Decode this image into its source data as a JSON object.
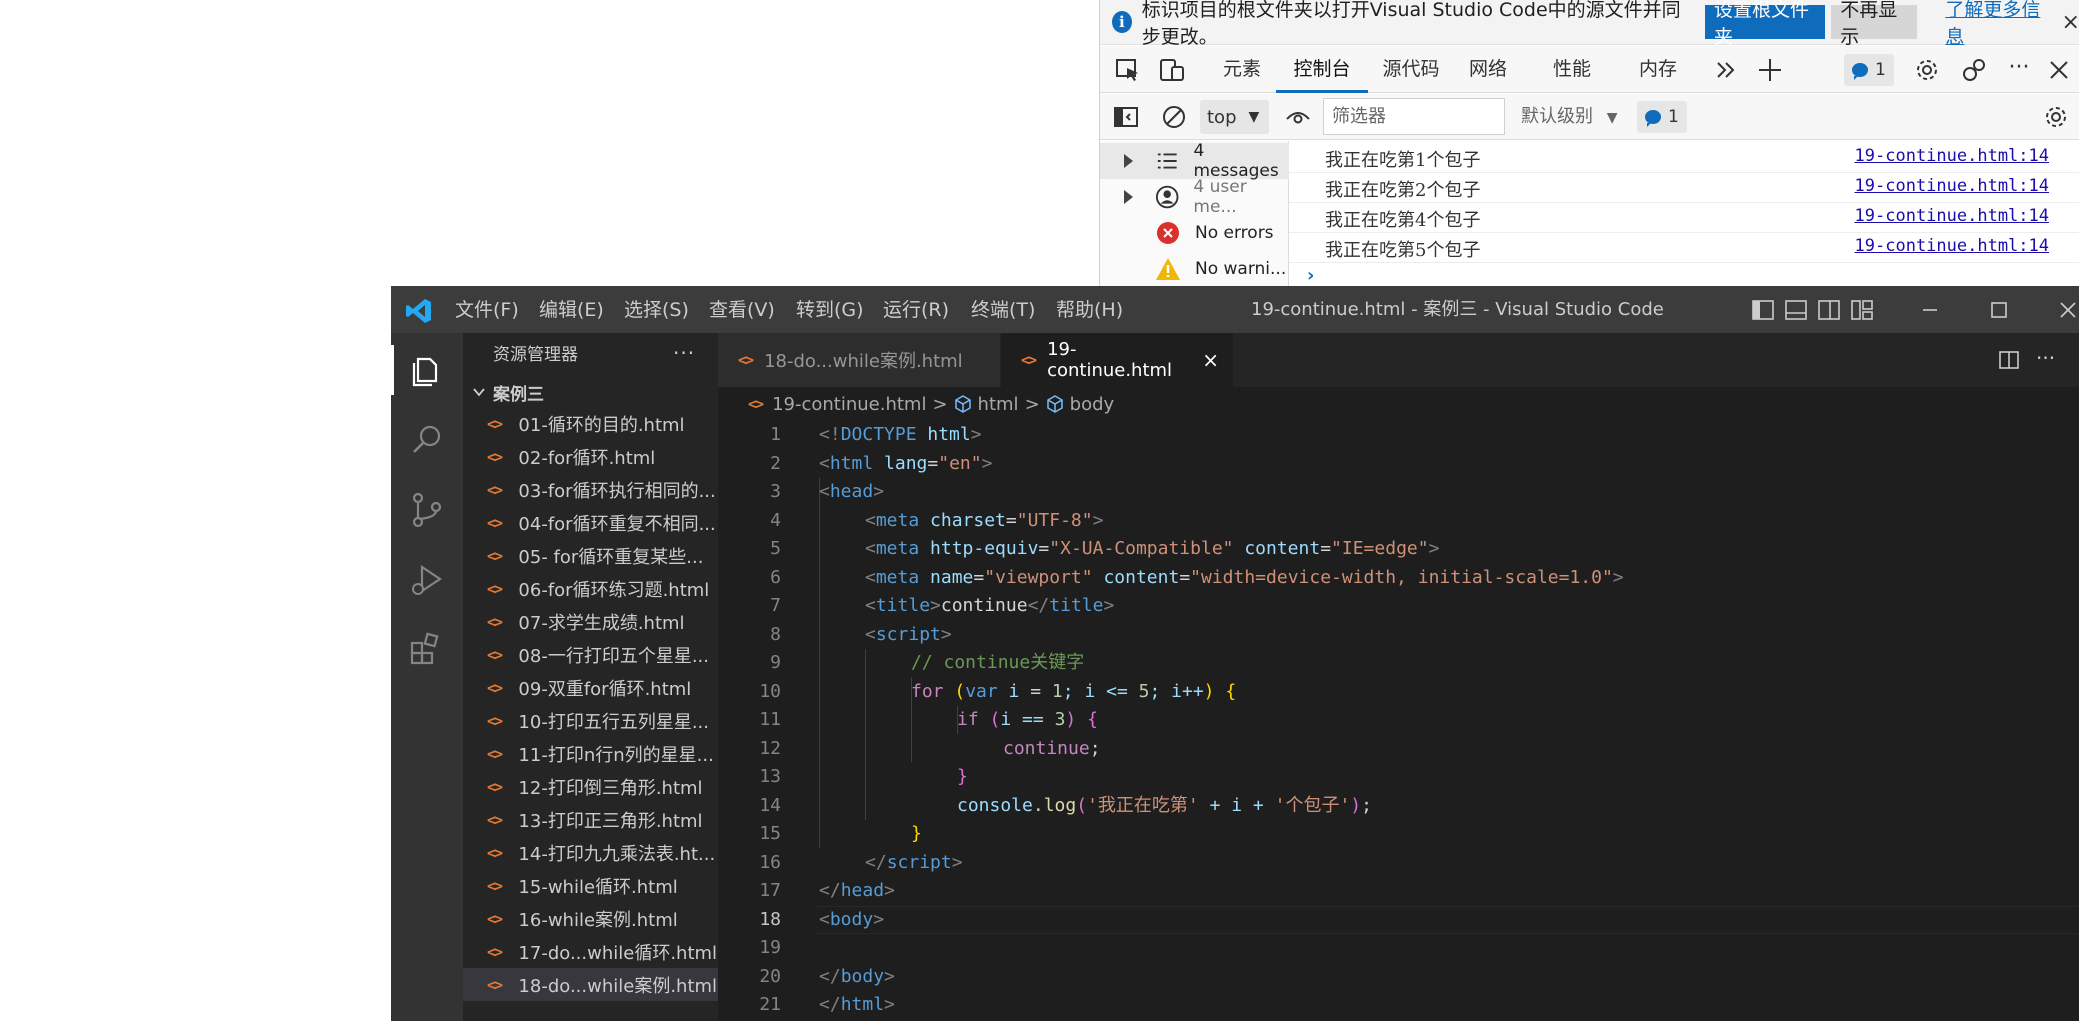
{
  "devtools": {
    "infobar": {
      "message": "标识项目的根文件夹以打开Visual Studio Code中的源文件并同步更改。",
      "primary_button": "设置根文件夹",
      "secondary_button": "不再显示",
      "link": "了解更多信息",
      "close": "×"
    },
    "tabs": [
      "元素",
      "控制台",
      "源代码",
      "网络",
      "性能",
      "内存"
    ],
    "active_tab": "控制台",
    "issues_count": "1",
    "console_toolbar": {
      "context": "top",
      "filter_placeholder": "筛选器",
      "level": "默认级别",
      "issues_count": "1"
    },
    "sidebar": [
      {
        "label": "4 messages",
        "icon": "list-icon"
      },
      {
        "label": "4 user me...",
        "icon": "user-icon"
      },
      {
        "label": "No errors",
        "icon": "error-icon"
      },
      {
        "label": "No warni...",
        "icon": "warning-icon"
      }
    ],
    "logs": [
      {
        "message": "我正在吃第1个包子",
        "source": "19-continue.html:14"
      },
      {
        "message": "我正在吃第2个包子",
        "source": "19-continue.html:14"
      },
      {
        "message": "我正在吃第4个包子",
        "source": "19-continue.html:14"
      },
      {
        "message": "我正在吃第5个包子",
        "source": "19-continue.html:14"
      }
    ],
    "prompt": "›"
  },
  "vscode": {
    "menu": [
      "文件(F)",
      "编辑(E)",
      "选择(S)",
      "查看(V)",
      "转到(G)",
      "运行(R)",
      "终端(T)",
      "帮助(H)"
    ],
    "window_title": "19-continue.html - 案例三 - Visual Studio Code",
    "explorer": {
      "title": "资源管理器",
      "more": "···",
      "folder": "案例三",
      "files": [
        "01-循环的目的.html",
        "02-for循环.html",
        "03-for循环执行相同的...",
        "04-for循环重复不相同...",
        "05- for循环重复某些...",
        "06-for循环练习题.html",
        "07-求学生成绩.html",
        "08-一行打印五个星星...",
        "09-双重for循环.html",
        "10-打印五行五列星星...",
        "11-打印n行n列的星星...",
        "12-打印倒三角形.html",
        "13-打印正三角形.html",
        "14-打印九九乘法表.ht...",
        "15-while循环.html",
        "16-while案例.html",
        "17-do...while循环.html",
        "18-do...while案例.html"
      ]
    },
    "tabs": [
      {
        "label": "18-do...while案例.html"
      },
      {
        "label": "19-continue.html",
        "close": "×"
      }
    ],
    "breadcrumb": {
      "file": "19-continue.html",
      "node1": "html",
      "node2": "body"
    },
    "line_numbers": [
      "1",
      "2",
      "3",
      "4",
      "5",
      "6",
      "7",
      "8",
      "9",
      "10",
      "11",
      "12",
      "13",
      "14",
      "15",
      "16",
      "17",
      "18",
      "19",
      "20",
      "21"
    ],
    "code": {
      "l1": [
        "<!",
        "DOCTYPE",
        " html",
        ">"
      ],
      "l2": [
        "<",
        "html",
        " lang",
        "=",
        "\"en\"",
        ">"
      ],
      "l3": [
        "<",
        "head",
        ">"
      ],
      "l4": [
        "<",
        "meta",
        " charset",
        "=",
        "\"UTF-8\"",
        ">"
      ],
      "l5": [
        "<",
        "meta",
        " http-equiv",
        "=",
        "\"X-UA-Compatible\"",
        " content",
        "=",
        "\"IE=edge\"",
        ">"
      ],
      "l6": [
        "<",
        "meta",
        " name",
        "=",
        "\"viewport\"",
        " content",
        "=",
        "\"width=device-width, initial-scale=1.0\"",
        ">"
      ],
      "l7": [
        "<",
        "title",
        ">",
        "continue",
        "</",
        "title",
        ">"
      ],
      "l8": [
        "<",
        "script",
        ">"
      ],
      "l9": [
        "// continue关键字"
      ],
      "l10": [
        "for",
        " ",
        "(",
        "var",
        " i ",
        "=",
        " ",
        "1",
        "; i <= ",
        "5",
        "; i++",
        ")",
        " ",
        "{"
      ],
      "l11": [
        "if",
        " ",
        "(",
        "i == ",
        "3",
        ")",
        " ",
        "{"
      ],
      "l12": [
        "continue",
        ";"
      ],
      "l13": [
        "}"
      ],
      "l14": [
        "console",
        ".",
        "log",
        "(",
        "'我正在吃第'",
        " + i + ",
        "'个包子'",
        ")",
        ";"
      ],
      "l15": [
        "}"
      ],
      "l16": [
        "</",
        "script",
        ">"
      ],
      "l17": [
        "</",
        "head",
        ">"
      ],
      "l18": [
        "<",
        "body",
        ">"
      ],
      "l20": [
        "</",
        "body",
        ">"
      ],
      "l21": [
        "</",
        "html",
        ">"
      ]
    }
  }
}
